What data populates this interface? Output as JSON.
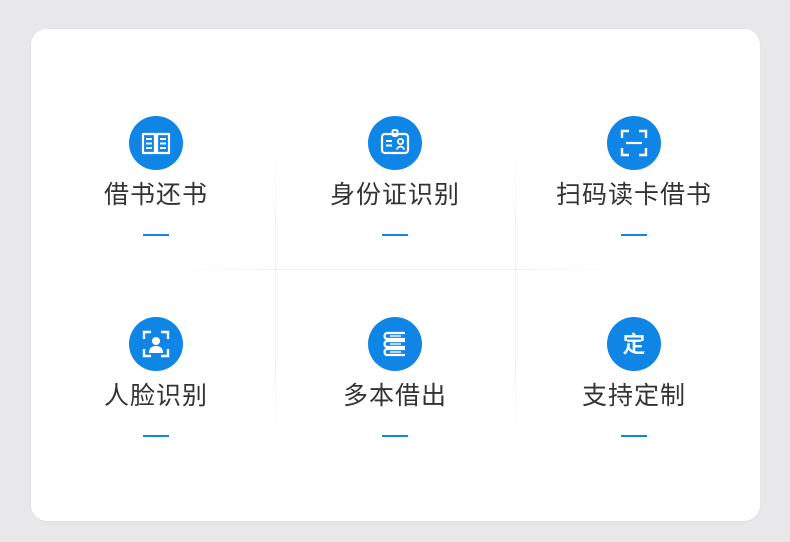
{
  "colors": {
    "accent": "#0f86e6",
    "label": "#333333",
    "card": "#ffffff",
    "background": "#e8e8ea"
  },
  "features": [
    {
      "label": "借书还书",
      "icon": "open-book-icon"
    },
    {
      "label": "身份证识别",
      "icon": "id-card-icon"
    },
    {
      "label": "扫码读卡借书",
      "icon": "scan-frame-icon"
    },
    {
      "label": "人脸识别",
      "icon": "face-scan-icon"
    },
    {
      "label": "多本借出",
      "icon": "stacked-books-icon"
    },
    {
      "label": "支持定制",
      "icon": "custom-icon",
      "icon_text": "定"
    }
  ]
}
